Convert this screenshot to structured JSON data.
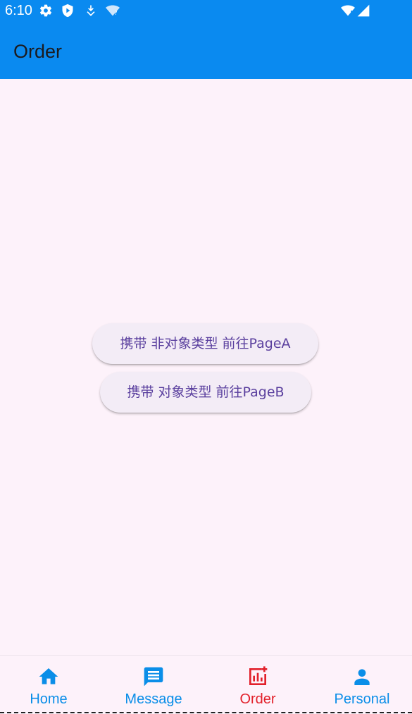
{
  "status_bar": {
    "time": "6:10",
    "icons": [
      "gear-icon",
      "shield-icon",
      "download-icon",
      "wifi-question-icon",
      "wifi-icon",
      "cellular-icon"
    ]
  },
  "app_bar": {
    "title": "Order"
  },
  "main": {
    "button_a": "携带 非对象类型 前往PageA",
    "button_b": "携带 对象类型 前往PageB"
  },
  "bottom_nav": {
    "items": [
      {
        "label": "Home",
        "icon": "home-icon",
        "selected": false
      },
      {
        "label": "Message",
        "icon": "message-icon",
        "selected": false
      },
      {
        "label": "Order",
        "icon": "order-icon",
        "selected": true
      },
      {
        "label": "Personal",
        "icon": "person-icon",
        "selected": false
      }
    ],
    "active_color": "#e2202a",
    "inactive_color": "#0a8ee8"
  },
  "colors": {
    "app_bar": "#0a8af0",
    "background": "#fdf2fa",
    "button_text": "#5a3f9e",
    "button_bg": "#f3ecf6"
  }
}
